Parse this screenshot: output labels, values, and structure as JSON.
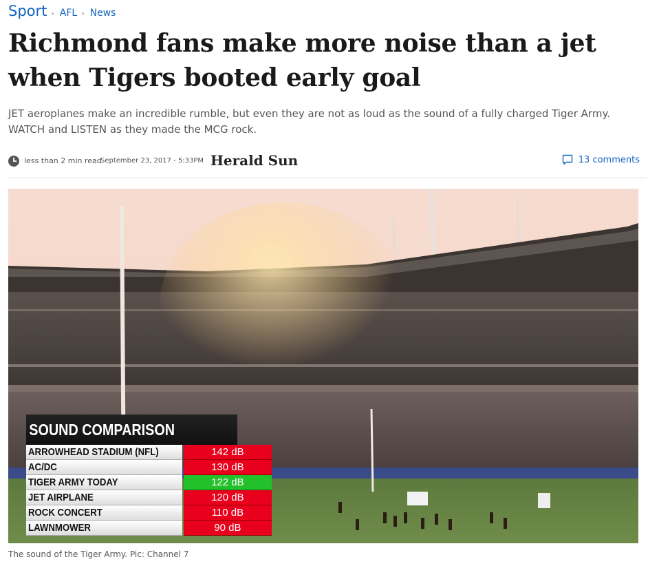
{
  "breadcrumb": {
    "section": "Sport",
    "subsection": "AFL",
    "category": "News"
  },
  "headline": "Richmond fans make more noise than a jet when Tigers booted early goal",
  "standfirst": "JET aeroplanes make an incredible rumble, but even they are not as loud as the sound of a fully charged Tiger Army. WATCH and LISTEN as they made the MCG rock.",
  "meta": {
    "read_time": "less than 2 min read",
    "date": "September 23, 2017 - 5:33PM",
    "masthead": "Herald Sun",
    "comments": "13 comments",
    "icons": {
      "clock": "clock-icon",
      "comments": "comment-icon"
    }
  },
  "graphic": {
    "title": "SOUND COMPARISON",
    "rows": [
      {
        "name": "ARROWHEAD STADIUM (NFL)",
        "value": "142 dB",
        "highlight": false
      },
      {
        "name": "AC/DC",
        "value": "130 dB",
        "highlight": false
      },
      {
        "name": "TIGER ARMY TODAY",
        "value": "122 dB",
        "highlight": true
      },
      {
        "name": "JET AIRPLANE",
        "value": "120 dB",
        "highlight": false
      },
      {
        "name": "ROCK CONCERT",
        "value": "110 dB",
        "highlight": false
      },
      {
        "name": "LAWNMOWER",
        "value": "90 dB",
        "highlight": false
      }
    ],
    "colors": {
      "bar": "#e8001c",
      "highlight_bar": "#22c02a",
      "title_bg": "#111111"
    }
  },
  "caption": "The sound of the Tiger Army. Pic: Channel 7",
  "colors": {
    "link": "#1565c0",
    "headline": "#1a1a1a"
  }
}
